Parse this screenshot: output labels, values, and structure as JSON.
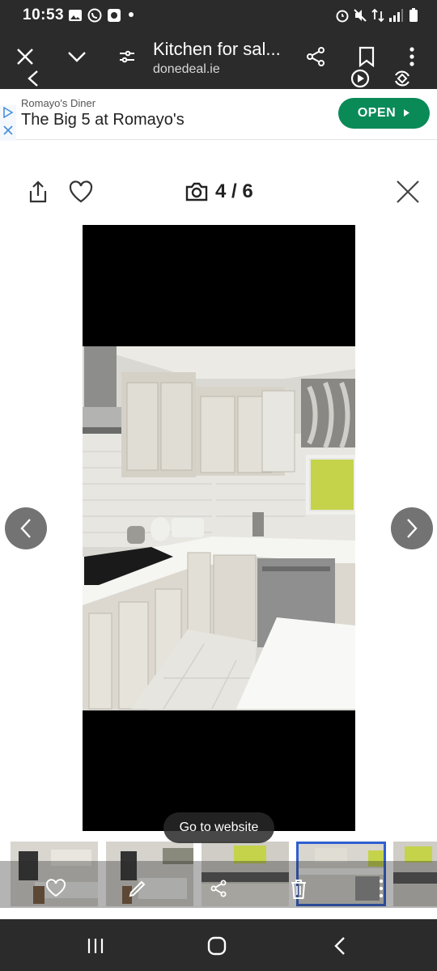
{
  "status_bar": {
    "time": "10:53"
  },
  "browser": {
    "tab_title": "Kitchen for sal...",
    "url": "donedeal.ie",
    "icons": [
      "close-icon",
      "chevron-down-icon",
      "tune-icon",
      "share-icon",
      "bookmark-icon",
      "more-icon",
      "back-icon",
      "video-icon",
      "rotate-icon"
    ]
  },
  "ad": {
    "sponsor": "Romayo's Diner",
    "headline": "The Big 5 at Romayo's",
    "cta": "OPEN"
  },
  "viewer": {
    "counter": "4 / 6",
    "go_to_website": "Go to website"
  },
  "thumbnails": {
    "count": 5,
    "active_index": 3
  },
  "colors": {
    "accent": "#0a8a57",
    "active_border": "#2f5fd0",
    "bar": "#2b2b2b"
  }
}
